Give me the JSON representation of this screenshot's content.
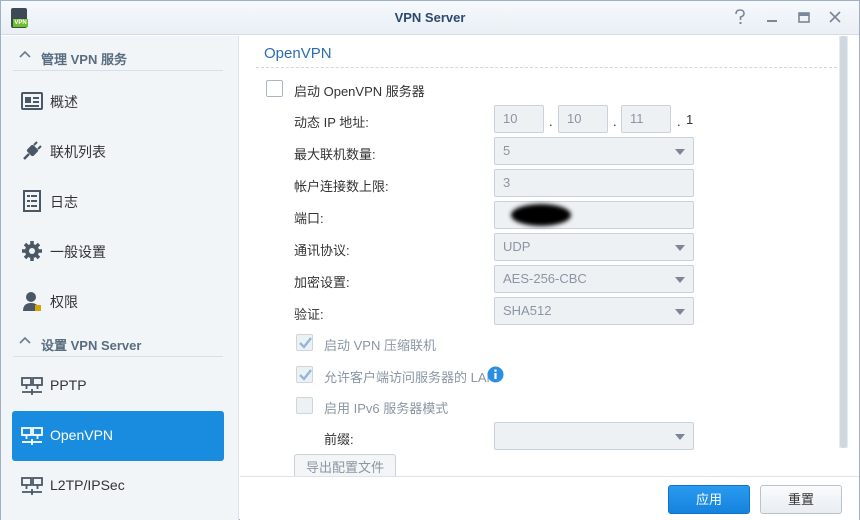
{
  "window": {
    "title": "VPN Server",
    "app_icon_badge": "VPN",
    "controls": [
      "help-icon",
      "minimize-icon",
      "maximize-icon",
      "close-icon"
    ]
  },
  "sidebar": {
    "section1": {
      "label": "管理 VPN 服务"
    },
    "items1": [
      {
        "label": "概述",
        "icon": "overview-icon"
      },
      {
        "label": "联机列表",
        "icon": "plug-icon"
      },
      {
        "label": "日志",
        "icon": "log-icon"
      },
      {
        "label": "一般设置",
        "icon": "gear-icon"
      },
      {
        "label": "权限",
        "icon": "user-icon"
      }
    ],
    "section2": {
      "label": "设置 VPN Server"
    },
    "items2": [
      {
        "label": "PPTP",
        "icon": "network-icon",
        "active": false
      },
      {
        "label": "OpenVPN",
        "icon": "network-icon",
        "active": true
      },
      {
        "label": "L2TP/IPSec",
        "icon": "network-icon",
        "active": false
      }
    ]
  },
  "main": {
    "panel_title": "OpenVPN",
    "enable_label": "启动 OpenVPN 服务器",
    "ip": {
      "label": "动态 IP 地址:",
      "octets": [
        "10",
        "10",
        "11"
      ],
      "last": "1",
      "dot": "."
    },
    "max_conn": {
      "label": "最大联机数量:",
      "value": "5"
    },
    "acct_limit": {
      "label": "帐户连接数上限:",
      "value": "3"
    },
    "port": {
      "label": "端口:",
      "value": ""
    },
    "protocol": {
      "label": "通讯协议:",
      "value": "UDP"
    },
    "encryption": {
      "label": "加密设置:",
      "value": "AES-256-CBC"
    },
    "auth": {
      "label": "验证:",
      "value": "SHA512"
    },
    "compress": {
      "label": "启动 VPN 压缩联机",
      "checked": true
    },
    "allow_lan": {
      "label": "允许客户端访问服务器的 LAN",
      "checked": true
    },
    "ipv6": {
      "label": "启用 IPv6 服务器模式",
      "checked": false
    },
    "prefix": {
      "label": "前缀:",
      "value": ""
    },
    "export_label": "导出配置文件"
  },
  "footer": {
    "apply": "应用",
    "reset": "重置"
  },
  "colors": {
    "accent": "#1a8ce0",
    "title": "#2b6cb0"
  }
}
